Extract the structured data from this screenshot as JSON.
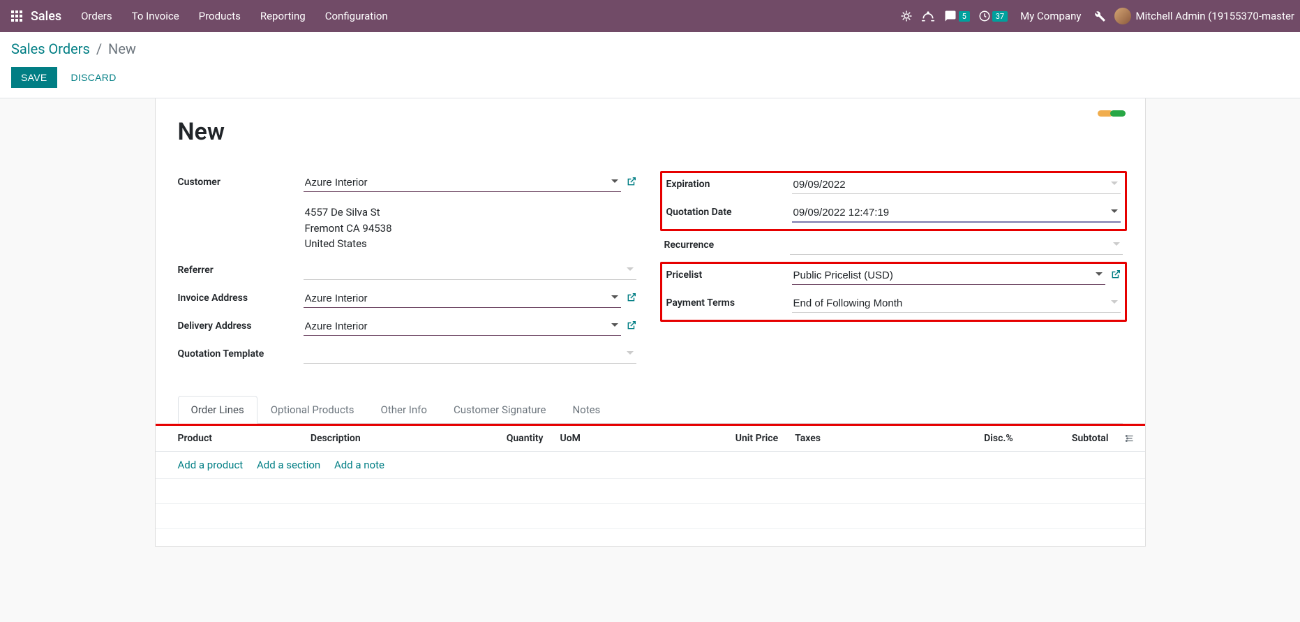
{
  "navbar": {
    "brand": "Sales",
    "menu": [
      "Orders",
      "To Invoice",
      "Products",
      "Reporting",
      "Configuration"
    ],
    "messages_badge": "5",
    "activities_badge": "37",
    "company": "My Company",
    "user": "Mitchell Admin (19155370-master"
  },
  "breadcrumb": {
    "root": "Sales Orders",
    "current": "New"
  },
  "buttons": {
    "save": "SAVE",
    "discard": "DISCARD"
  },
  "form": {
    "title": "New",
    "left": {
      "customer_label": "Customer",
      "customer_value": "Azure Interior",
      "address_line1": "4557 De Silva St",
      "address_line2": "Fremont CA 94538",
      "address_line3": "United States",
      "referrer_label": "Referrer",
      "referrer_value": "",
      "invoice_addr_label": "Invoice Address",
      "invoice_addr_value": "Azure Interior",
      "delivery_addr_label": "Delivery Address",
      "delivery_addr_value": "Azure Interior",
      "template_label": "Quotation Template",
      "template_value": ""
    },
    "right": {
      "expiration_label": "Expiration",
      "expiration_value": "09/09/2022",
      "quotation_date_label": "Quotation Date",
      "quotation_date_value": "09/09/2022 12:47:19",
      "recurrence_label": "Recurrence",
      "recurrence_value": "",
      "pricelist_label": "Pricelist",
      "pricelist_value": "Public Pricelist (USD)",
      "payment_terms_label": "Payment Terms",
      "payment_terms_value": "End of Following Month"
    }
  },
  "tabs": [
    "Order Lines",
    "Optional Products",
    "Other Info",
    "Customer Signature",
    "Notes"
  ],
  "table": {
    "headers": {
      "product": "Product",
      "description": "Description",
      "quantity": "Quantity",
      "uom": "UoM",
      "unit_price": "Unit Price",
      "taxes": "Taxes",
      "disc": "Disc.%",
      "subtotal": "Subtotal"
    },
    "actions": {
      "add_product": "Add a product",
      "add_section": "Add a section",
      "add_note": "Add a note"
    }
  }
}
